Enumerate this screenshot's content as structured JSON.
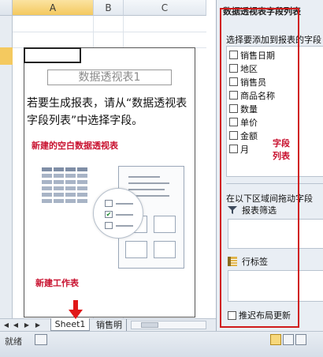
{
  "columns": [
    "A",
    "B",
    "C"
  ],
  "pivot": {
    "title": "数据透视表1",
    "instruction": "若要生成报表，请从“数据透视表字段列表”中选择字段。"
  },
  "annotations": {
    "empty_pivot": "新建的空白数据透视表",
    "new_worksheet": "新建工作表",
    "field_list": "字段\n列表"
  },
  "tabs": {
    "active": "Sheet1",
    "other": "销售明"
  },
  "status": {
    "ready_text": "就绪"
  },
  "field_pane": {
    "title": "数据透视表字段列表",
    "prompt": "选择要添加到报表的字段",
    "fields": [
      "销售日期",
      "地区",
      "销售员",
      "商品名称",
      "数量",
      "单价",
      "金额",
      "月"
    ],
    "area_prompt": "在以下区域间拖动字段",
    "report_filter": "报表筛选",
    "row_labels": "行标签",
    "defer_update": "推迟布局更新"
  },
  "colors": {
    "annotation_red": "#c8102e",
    "selected_column": "#f4c95f"
  },
  "icons": {
    "filter": "filter-icon",
    "row_labels": "row-labels-icon"
  }
}
